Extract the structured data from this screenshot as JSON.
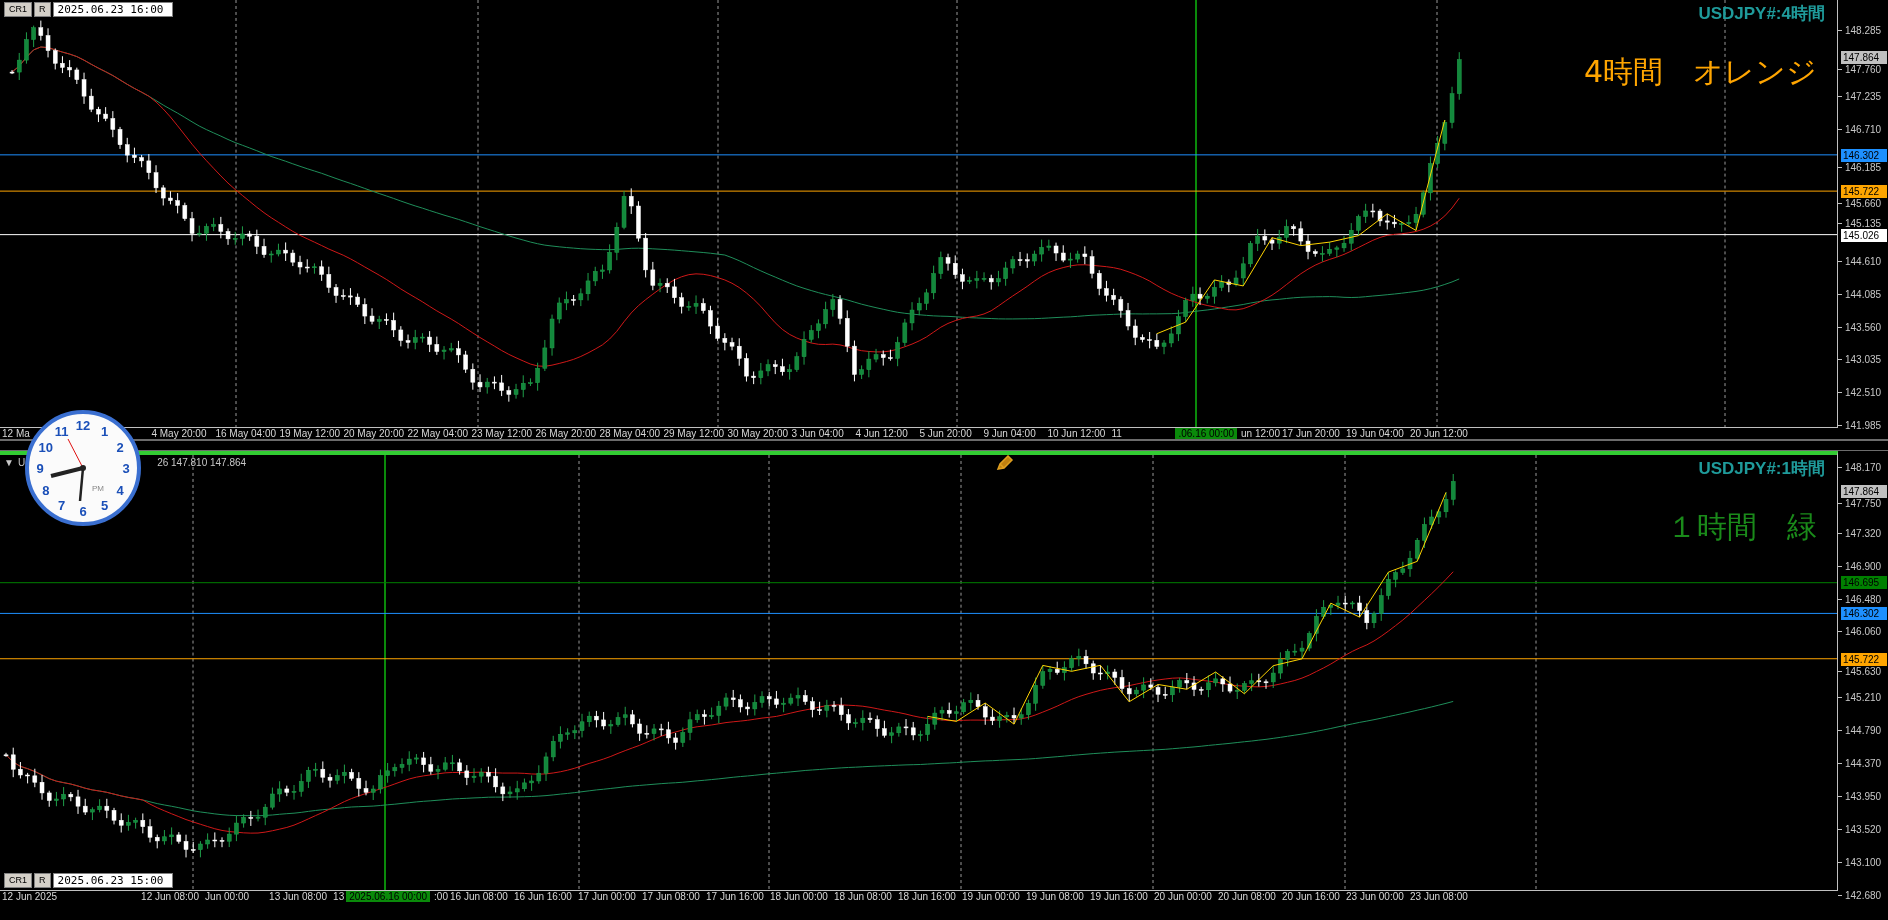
{
  "panels": [
    {
      "info": {
        "buttons": [
          "CR1",
          "R"
        ],
        "time": "2025.06.23 16:00"
      },
      "title": "USDJPY#:4時間",
      "note": "4時間　オレンジ",
      "color": "#ffa500",
      "price_ticks": [
        "148.285",
        "147.760",
        "147.235",
        "146.710",
        "146.185",
        "145.660",
        "145.135",
        "144.610",
        "144.085",
        "143.560",
        "143.035",
        "142.510",
        "141.985"
      ],
      "current_price": "147.864",
      "levels": [
        {
          "price": "146.302",
          "color": "#1e90ff"
        },
        {
          "price": "145.722",
          "color": "#ffa500"
        },
        {
          "price": "145.026",
          "color": "#ffffff"
        }
      ],
      "time_labels": [
        {
          "kind": "label",
          "text": "12 Ma"
        },
        {
          "kind": "label",
          "text": "4 May 20:00"
        },
        {
          "kind": "label",
          "text": "16 May 04:00"
        },
        {
          "kind": "label",
          "text": "19 May 12:00"
        },
        {
          "kind": "label",
          "text": "20 May 20:00"
        },
        {
          "kind": "label",
          "text": "22 May 04:00"
        },
        {
          "kind": "label",
          "text": "23 May 12:00"
        },
        {
          "kind": "label",
          "text": "26 May 20:00"
        },
        {
          "kind": "label",
          "text": "28 May 04:00"
        },
        {
          "kind": "label",
          "text": "29 May 12:00"
        },
        {
          "kind": "label",
          "text": "30 May 20:00"
        },
        {
          "kind": "label",
          "text": "3 Jun 04:00"
        },
        {
          "kind": "label",
          "text": "4 Jun 12:00"
        },
        {
          "kind": "label",
          "text": "5 Jun 20:00"
        },
        {
          "kind": "label",
          "text": "9 Jun 04:00"
        },
        {
          "kind": "label",
          "text": "10 Jun 12:00"
        },
        {
          "kind": "label",
          "text": "11"
        },
        {
          "kind": "marker",
          "text": ".06.16 00:00"
        },
        {
          "kind": "fragment",
          "text": "un 12:00"
        },
        {
          "kind": "label",
          "text": "17 Jun 20:00"
        },
        {
          "kind": "label",
          "text": "19 Jun 04:00"
        },
        {
          "kind": "label",
          "text": "20 Jun 12:00"
        }
      ]
    },
    {
      "header": {
        "toggle": "▼",
        "symbol": "U",
        "values": "26 147.810 147.864"
      },
      "info": {
        "buttons": [
          "CR1",
          "R"
        ],
        "time": "2025.06.23 15:00"
      },
      "title": "USDJPY#:1時間",
      "note": "１時間　緑",
      "color": "#1a8a1a",
      "price_ticks": [
        "148.170",
        "147.750",
        "147.320",
        "146.900",
        "146.480",
        "146.060",
        "145.630",
        "145.210",
        "144.790",
        "144.370",
        "143.950",
        "143.520",
        "143.100",
        "142.680"
      ],
      "current_price": "147.864",
      "levels": [
        {
          "price": "146.695",
          "color": "#008000"
        },
        {
          "price": "146.302",
          "color": "#1e90ff"
        },
        {
          "price": "145.722",
          "color": "#ffa500"
        }
      ],
      "time_labels": [
        {
          "kind": "label",
          "text": "12 Jun 2025"
        },
        {
          "kind": "label",
          "text": "12 Jun 08:00"
        },
        {
          "kind": "label",
          "text": "Jun 00:00"
        },
        {
          "kind": "label",
          "text": "13 Jun 08:00"
        },
        {
          "kind": "fragment",
          "text": "13"
        },
        {
          "kind": "marker",
          "text": "2025.06.16 00:00"
        },
        {
          "kind": "fragment",
          "text": ":00"
        },
        {
          "kind": "label",
          "text": "16 Jun 08:00"
        },
        {
          "kind": "label",
          "text": "16 Jun 16:00"
        },
        {
          "kind": "label",
          "text": "17 Jun 00:00"
        },
        {
          "kind": "label",
          "text": "17 Jun 08:00"
        },
        {
          "kind": "label",
          "text": "17 Jun 16:00"
        },
        {
          "kind": "label",
          "text": "18 Jun 00:00"
        },
        {
          "kind": "label",
          "text": "18 Jun 08:00"
        },
        {
          "kind": "label",
          "text": "18 Jun 16:00"
        },
        {
          "kind": "label",
          "text": "19 Jun 00:00"
        },
        {
          "kind": "label",
          "text": "19 Jun 08:00"
        },
        {
          "kind": "label",
          "text": "19 Jun 16:00"
        },
        {
          "kind": "label",
          "text": "20 Jun 00:00"
        },
        {
          "kind": "label",
          "text": "20 Jun 08:00"
        },
        {
          "kind": "label",
          "text": "20 Jun 16:00"
        },
        {
          "kind": "label",
          "text": "23 Jun 00:00"
        },
        {
          "kind": "label",
          "text": "23 Jun 08:00"
        }
      ]
    }
  ],
  "clock": {
    "numerals": [
      "12",
      "11",
      "1",
      "10",
      "2",
      "9",
      "3",
      "8",
      "4",
      "7",
      "5",
      "6"
    ],
    "period": "PM"
  }
}
